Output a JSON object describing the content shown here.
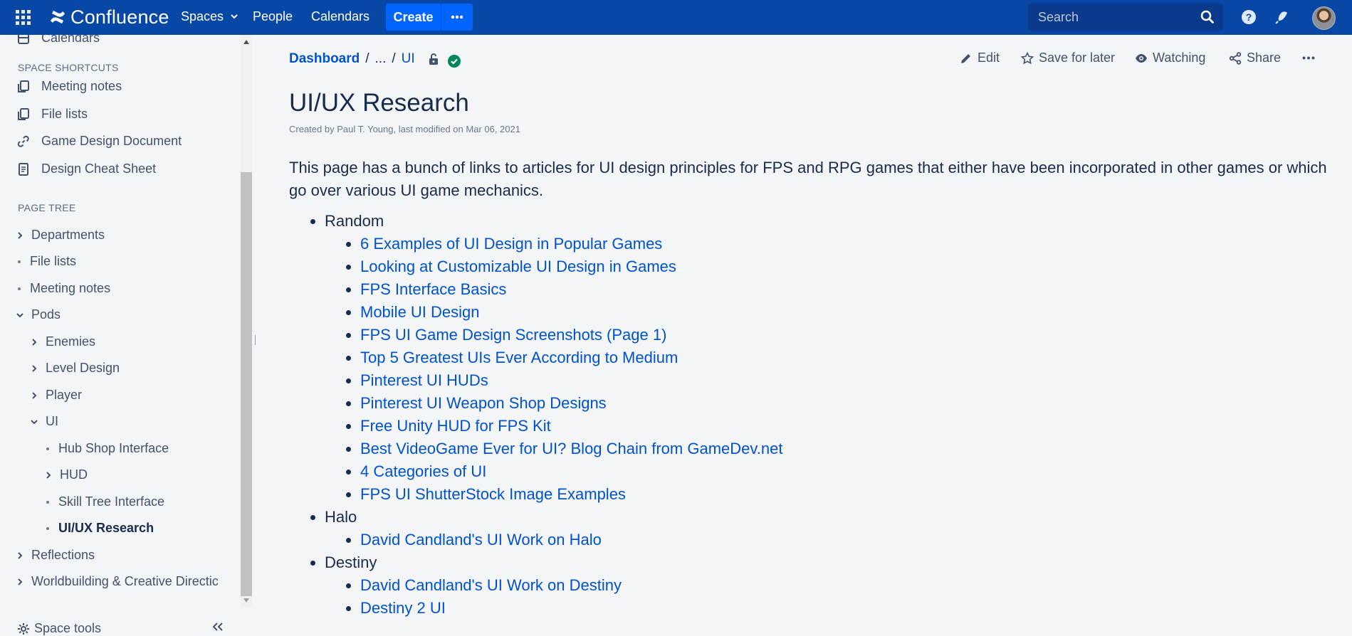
{
  "app": {
    "name": "Confluence",
    "accent_color": "#0747a6",
    "link_color": "#0052cc"
  },
  "topnav": {
    "spaces_label": "Spaces",
    "people_label": "People",
    "calendars_label": "Calendars",
    "create_label": "Create",
    "search_placeholder": "Search",
    "icons": [
      "app-switcher-icon",
      "confluence-logo",
      "chevron-down-icon",
      "more-icon",
      "search-icon",
      "help-icon",
      "notifications-icon",
      "avatar"
    ]
  },
  "sidebar": {
    "calendars_label": "Calendars",
    "shortcuts_heading": "SPACE SHORTCUTS",
    "shortcuts": [
      {
        "label": "Meeting notes",
        "icon": "pages-icon"
      },
      {
        "label": "File lists",
        "icon": "pages-icon"
      },
      {
        "label": "Game Design Document",
        "icon": "link-icon"
      },
      {
        "label": "Design Cheat Sheet",
        "icon": "page-icon"
      }
    ],
    "tree_heading": "PAGE TREE",
    "tree": [
      {
        "label": "Departments",
        "depth": 0,
        "kind": "collapsed"
      },
      {
        "label": "File lists",
        "depth": 0,
        "kind": "leaf"
      },
      {
        "label": "Meeting notes",
        "depth": 0,
        "kind": "leaf"
      },
      {
        "label": "Pods",
        "depth": 0,
        "kind": "expanded"
      },
      {
        "label": "Enemies",
        "depth": 1,
        "kind": "collapsed"
      },
      {
        "label": "Level Design",
        "depth": 1,
        "kind": "collapsed"
      },
      {
        "label": "Player",
        "depth": 1,
        "kind": "collapsed"
      },
      {
        "label": "UI",
        "depth": 1,
        "kind": "expanded"
      },
      {
        "label": "Hub Shop Interface",
        "depth": 2,
        "kind": "leaf"
      },
      {
        "label": "HUD",
        "depth": 2,
        "kind": "collapsed"
      },
      {
        "label": "Skill Tree Interface",
        "depth": 2,
        "kind": "leaf"
      },
      {
        "label": "UI/UX Research",
        "depth": 2,
        "kind": "current"
      },
      {
        "label": "Reflections",
        "depth": 0,
        "kind": "collapsed"
      },
      {
        "label": "Worldbuilding & Creative Directic",
        "depth": 0,
        "kind": "collapsed"
      }
    ],
    "space_tools_label": "Space tools"
  },
  "page": {
    "breadcrumb": {
      "dashboard": "Dashboard",
      "ellipsis": "...",
      "parent": "UI",
      "separator": "/"
    },
    "actions": {
      "edit": "Edit",
      "save_for_later": "Save for later",
      "watching": "Watching",
      "share": "Share"
    },
    "title": "UI/UX Research",
    "byline": "Created by Paul T. Young, last modified on Mar 06, 2021",
    "intro": "This page has a bunch of links to articles for UI design principles for FPS and RPG games that either have been incorporated in other games or which go over various UI game mechanics.",
    "sections": [
      {
        "heading": "Random",
        "links": [
          "6 Examples of UI Design in Popular Games",
          "Looking at Customizable UI Design in Games",
          "FPS Interface Basics",
          "Mobile UI Design",
          "FPS UI Game Design Screenshots (Page 1)",
          "Top 5 Greatest UIs Ever According to Medium",
          "Pinterest UI HUDs",
          "Pinterest UI Weapon Shop Designs",
          "Free Unity HUD for FPS Kit",
          "Best VideoGame Ever for UI? Blog Chain from GameDev.net",
          "4 Categories of UI",
          "FPS UI ShutterStock Image Examples"
        ]
      },
      {
        "heading": "Halo",
        "links": [
          "David Candland's UI Work on Halo"
        ]
      },
      {
        "heading": "Destiny",
        "links": [
          "David Candland's UI Work on Destiny",
          "Destiny 2 UI"
        ]
      }
    ]
  }
}
